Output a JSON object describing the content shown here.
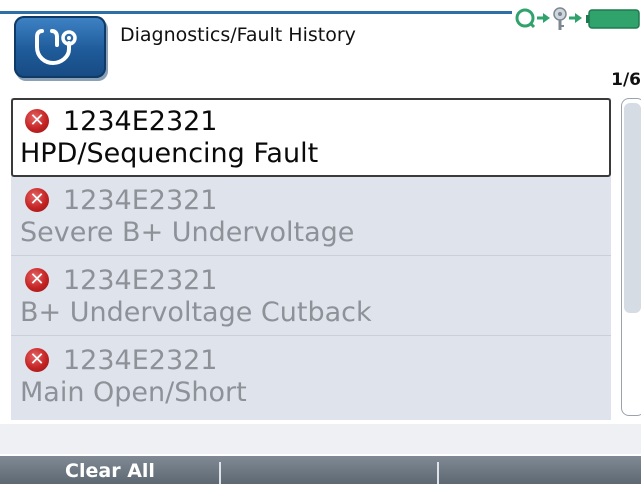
{
  "header": {
    "title": "Diagnostics/Fault History",
    "app_icon": "stethoscope-icon",
    "status_icons": [
      "connection-icon",
      "arrow-right-icon",
      "key-icon",
      "arrow-right-icon",
      "battery-icon"
    ]
  },
  "page_counter": "1/6",
  "faults": [
    {
      "code": "1234E2321",
      "description": "HPD/Sequencing Fault",
      "selected": true,
      "icon": "fault-x-icon"
    },
    {
      "code": "1234E2321",
      "description": "Severe B+ Undervoltage",
      "selected": false,
      "icon": "fault-x-icon"
    },
    {
      "code": "1234E2321",
      "description": "B+ Undervoltage Cutback",
      "selected": false,
      "icon": "fault-x-icon"
    },
    {
      "code": "1234E2321",
      "description": "Main Open/Short",
      "selected": false,
      "icon": "fault-x-icon"
    }
  ],
  "softkeys": [
    "Clear All",
    "",
    ""
  ],
  "colors": {
    "accent": "#2e6fa8",
    "status_green": "#2fa36b",
    "fault_red": "#c42424",
    "list_background": "#dfe4ec",
    "softkey_bar": "#6e7982"
  }
}
